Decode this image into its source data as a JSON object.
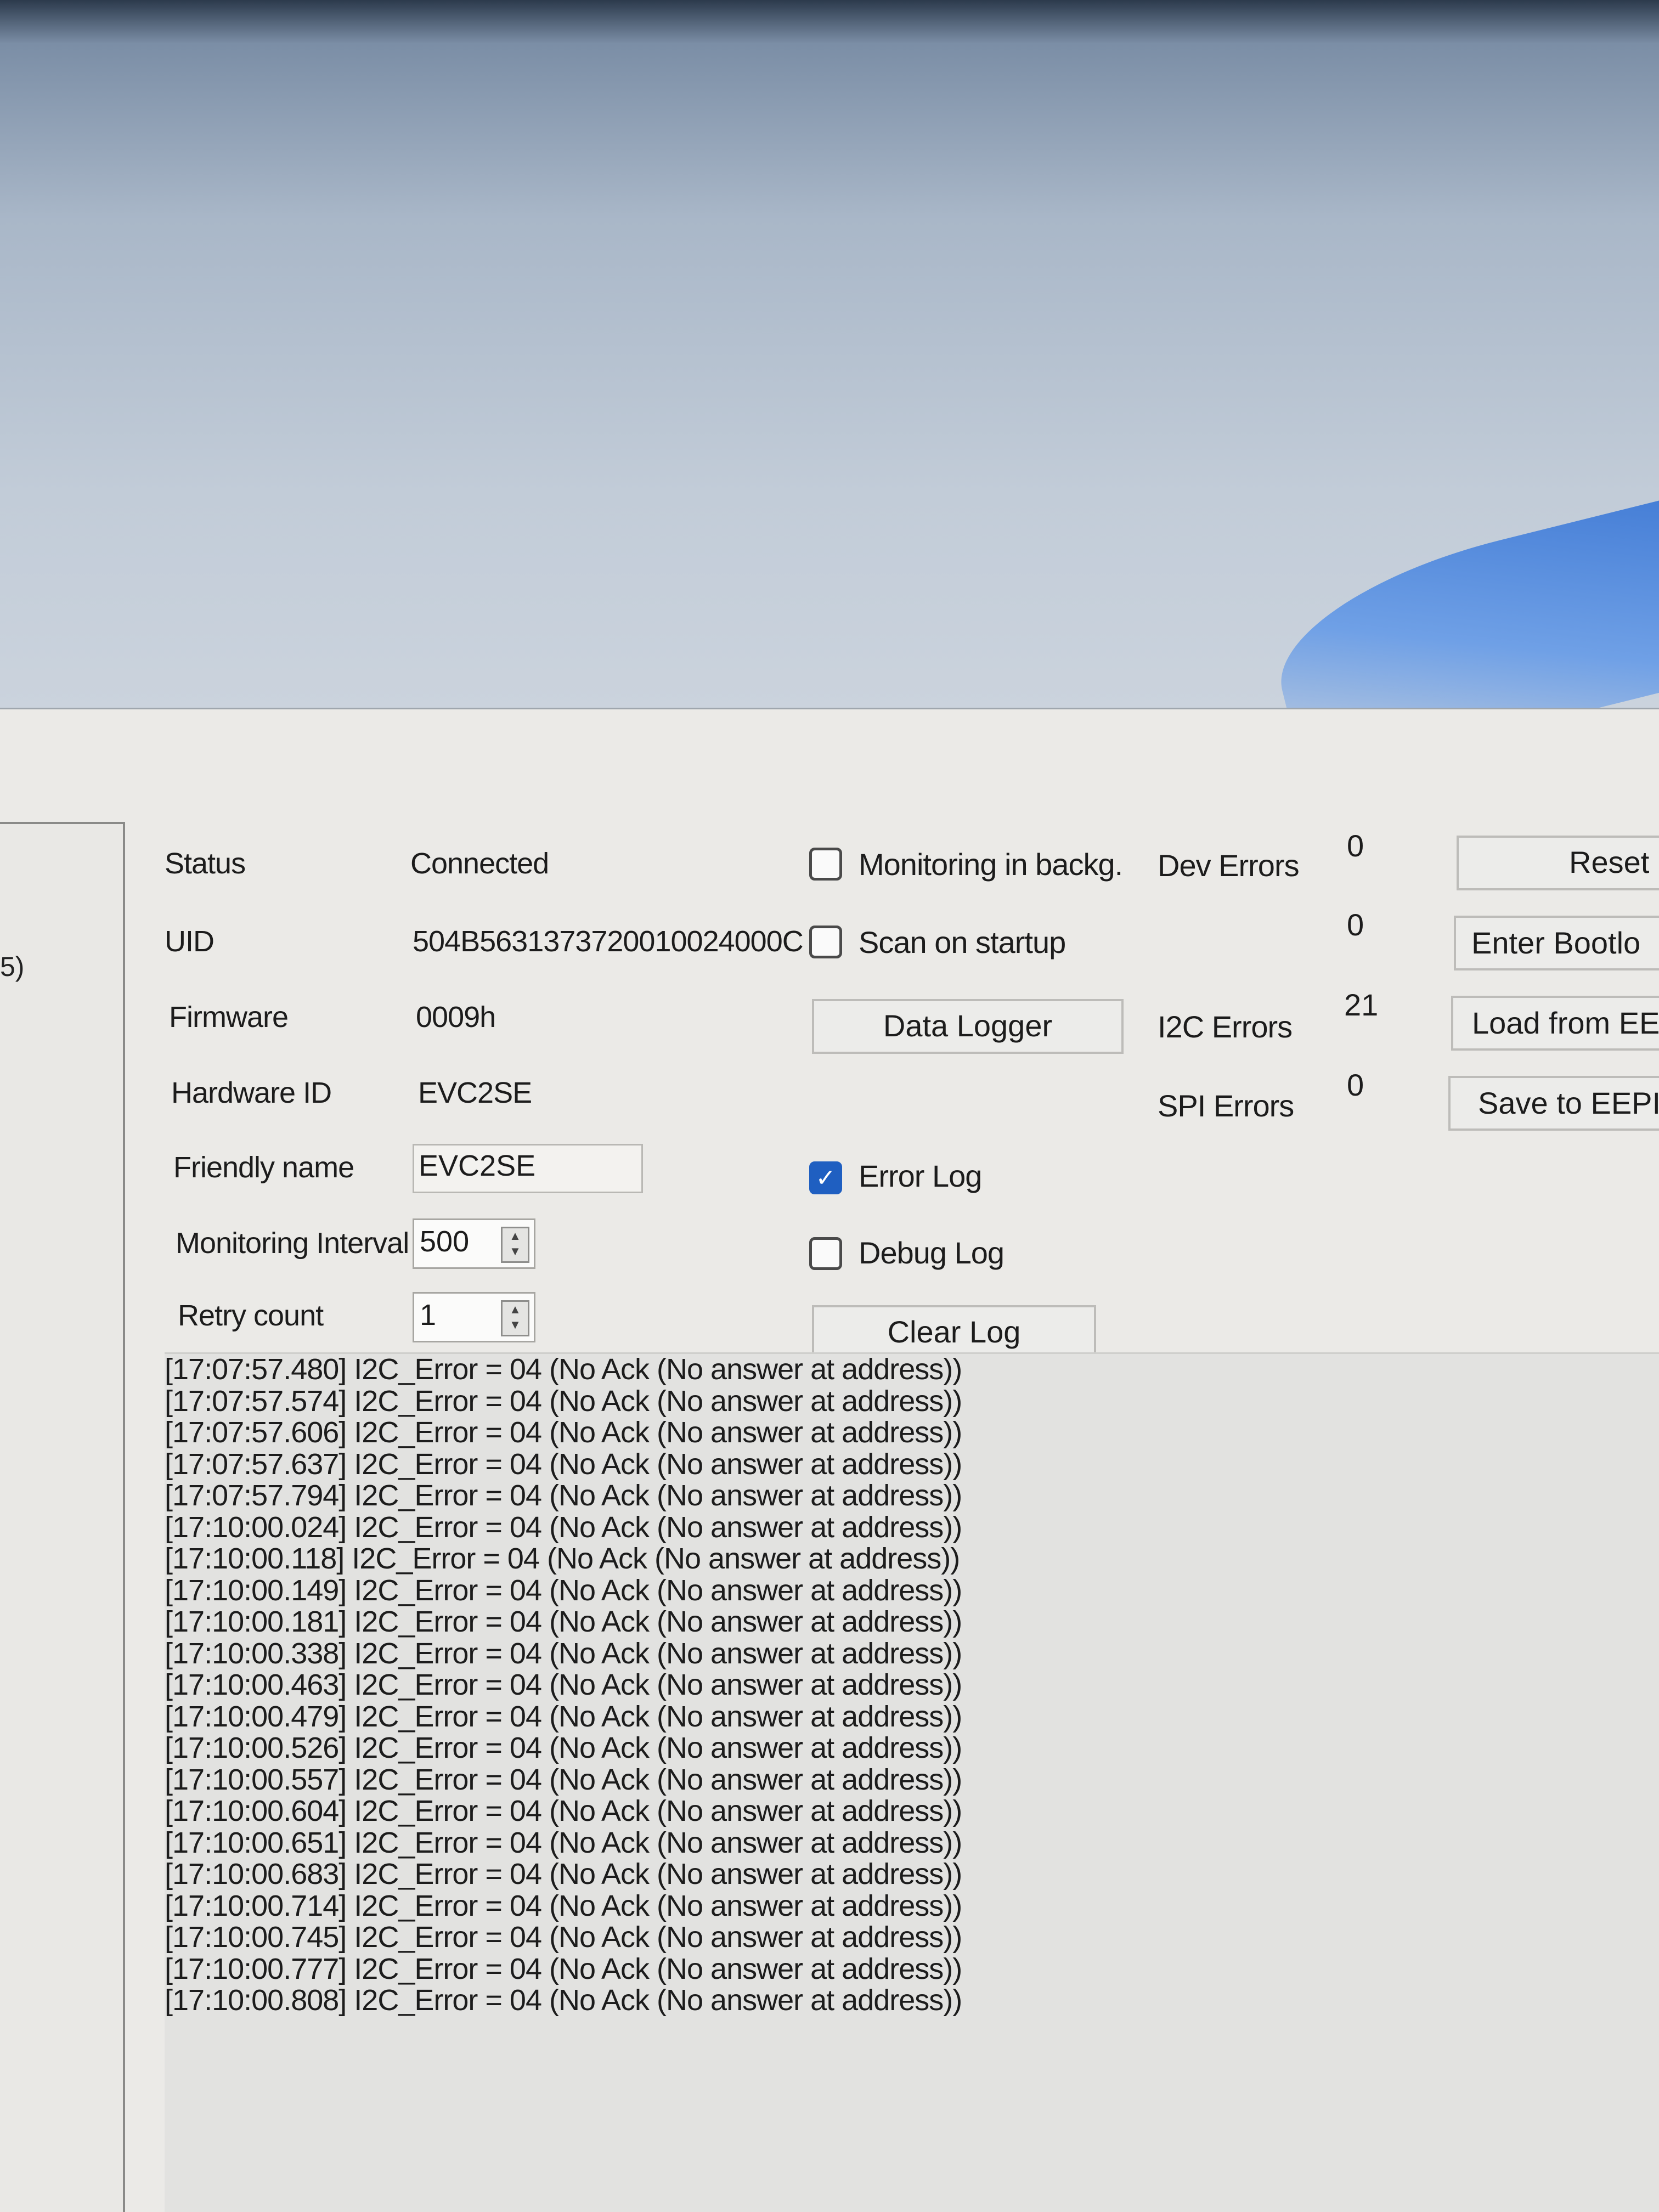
{
  "side": {
    "label": "5)"
  },
  "info": {
    "status_label": "Status",
    "status_value": "Connected",
    "uid_label": "UID",
    "uid_value": "504B5631373720010024000C",
    "firmware_label": "Firmware",
    "firmware_value": "0009h",
    "hardware_label": "Hardware ID",
    "hardware_value": "EVC2SE",
    "friendly_label": "Friendly name",
    "friendly_value": "EVC2SE",
    "interval_label": "Monitoring Interval",
    "interval_value": "500",
    "retry_label": "Retry count",
    "retry_value": "1"
  },
  "options": {
    "monitoring_label": "Monitoring in backg.",
    "monitoring_checked": false,
    "scan_label": "Scan on startup",
    "scan_checked": false,
    "data_logger": "Data Logger",
    "error_log_label": "Error Log",
    "error_log_checked": true,
    "debug_log_label": "Debug Log",
    "debug_log_checked": false,
    "clear_log": "Clear Log"
  },
  "errors": {
    "dev_label": "Dev Errors",
    "dev_value": "0",
    "row2_value": "0",
    "i2c_label": "I2C Errors",
    "i2c_value": "21",
    "spi_label": "SPI Errors",
    "spi_value": "0"
  },
  "actions": {
    "reset": "Reset",
    "bootloader": "Enter Bootlo",
    "load": "Load from EEF",
    "save": "Save to EEPI"
  },
  "log": [
    "[17:07:57.480] I2C_Error = 04 (No Ack (No answer at address))",
    "[17:07:57.574] I2C_Error = 04 (No Ack (No answer at address))",
    "[17:07:57.606] I2C_Error = 04 (No Ack (No answer at address))",
    "[17:07:57.637] I2C_Error = 04 (No Ack (No answer at address))",
    "[17:07:57.794] I2C_Error = 04 (No Ack (No answer at address))",
    "[17:10:00.024] I2C_Error = 04 (No Ack (No answer at address))",
    "[17:10:00.118] I2C_Error = 04 (No Ack (No answer at address))",
    "[17:10:00.149] I2C_Error = 04 (No Ack (No answer at address))",
    "[17:10:00.181] I2C_Error = 04 (No Ack (No answer at address))",
    "[17:10:00.338] I2C_Error = 04 (No Ack (No answer at address))",
    "[17:10:00.463] I2C_Error = 04 (No Ack (No answer at address))",
    "[17:10:00.479] I2C_Error = 04 (No Ack (No answer at address))",
    "[17:10:00.526] I2C_Error = 04 (No Ack (No answer at address))",
    "[17:10:00.557] I2C_Error = 04 (No Ack (No answer at address))",
    "[17:10:00.604] I2C_Error = 04 (No Ack (No answer at address))",
    "[17:10:00.651] I2C_Error = 04 (No Ack (No answer at address))",
    "[17:10:00.683] I2C_Error = 04 (No Ack (No answer at address))",
    "[17:10:00.714] I2C_Error = 04 (No Ack (No answer at address))",
    "[17:10:00.745] I2C_Error = 04 (No Ack (No answer at address))",
    "[17:10:00.777] I2C_Error = 04 (No Ack (No answer at address))",
    "[17:10:00.808] I2C_Error = 04 (No Ack (No answer at address))"
  ]
}
